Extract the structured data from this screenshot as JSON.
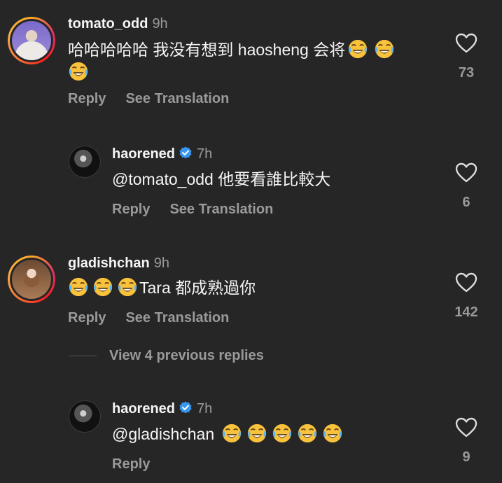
{
  "comments": [
    {
      "username": "tomato_odd",
      "time": "9h",
      "text": "哈哈哈哈哈 我没有想到 haosheng 会将",
      "likes": "73",
      "reply_label": "Reply",
      "translate_label": "See Translation"
    },
    {
      "username": "haorened",
      "time": "7h",
      "text": "@tomato_odd 他要看誰比較大",
      "likes": "6",
      "reply_label": "Reply",
      "translate_label": "See Translation"
    },
    {
      "username": "gladishchan",
      "time": "9h",
      "text": "Tara 都成熟過你",
      "likes": "142",
      "reply_label": "Reply",
      "translate_label": "See Translation"
    },
    {
      "username": "haorened",
      "time": "7h",
      "text": "@gladishchan",
      "likes": "9",
      "reply_label": "Reply"
    }
  ],
  "view_previous_replies": "View 4 previous replies",
  "icons": {
    "like": "heart-outline-icon",
    "verified": "verified-badge-icon",
    "emoji": "face-with-tears-of-joy-emoji"
  },
  "colors": {
    "background": "#262626",
    "text": "#f5f5f5",
    "secondary": "#9a9a9a",
    "verified": "#3897f0"
  }
}
